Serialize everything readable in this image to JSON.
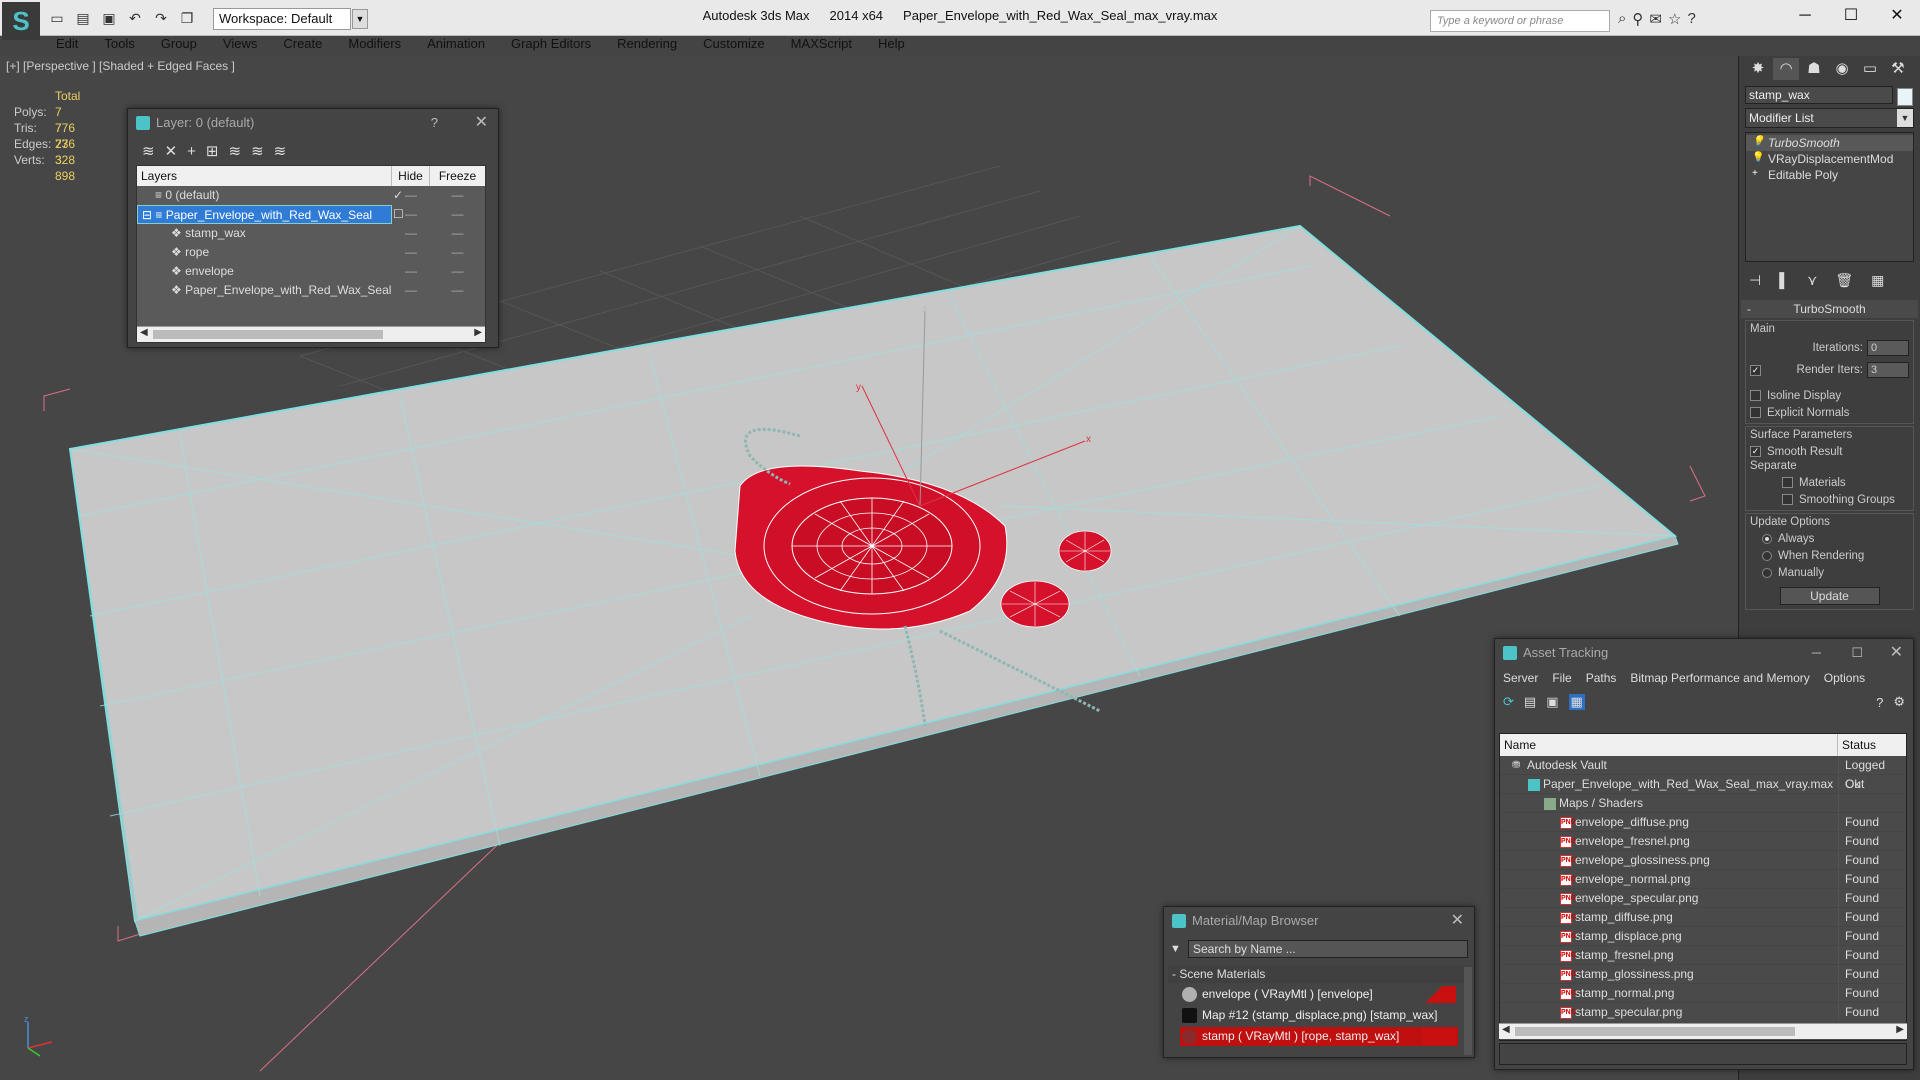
{
  "app": {
    "name": "Autodesk 3ds Max",
    "version": "2014 x64",
    "file": "Paper_Envelope_with_Red_Wax_Seal_max_vray.max",
    "workspace": "Workspace: Default",
    "search_placeholder": "Type a keyword or phrase"
  },
  "menu": [
    "Edit",
    "Tools",
    "Group",
    "Views",
    "Create",
    "Modifiers",
    "Animation",
    "Graph Editors",
    "Rendering",
    "Customize",
    "MAXScript",
    "Help"
  ],
  "viewport": {
    "label": "[+] [Perspective ] [Shaded + Edged Faces ]",
    "stats": {
      "header": "Total",
      "rows": [
        {
          "label": "Polys:",
          "value": "7 776"
        },
        {
          "label": "Tris:",
          "value": "7 776"
        },
        {
          "label": "Edges:",
          "value": "23 328"
        },
        {
          "label": "Verts:",
          "value": "3 898"
        }
      ]
    },
    "axis_labels": {
      "x": "x",
      "y": "y",
      "z": "z"
    }
  },
  "layer_dialog": {
    "title": "Layer: 0 (default)",
    "help": "?",
    "close": "✕",
    "columns": {
      "name": "Layers",
      "hide": "Hide",
      "freeze": "Freeze"
    },
    "rows": [
      {
        "name": "0 (default)",
        "indent": 1,
        "current": "✓",
        "hide": "—",
        "freeze": "—"
      },
      {
        "name": "Paper_Envelope_with_Red_Wax_Seal",
        "indent": 1,
        "selected": true,
        "current": "☐",
        "hide": "—",
        "freeze": "—"
      },
      {
        "name": "stamp_wax",
        "indent": 2,
        "current": "",
        "hide": "—",
        "freeze": "—"
      },
      {
        "name": "rope",
        "indent": 2,
        "current": "",
        "hide": "—",
        "freeze": "—"
      },
      {
        "name": "envelope",
        "indent": 2,
        "current": "",
        "hide": "—",
        "freeze": "—"
      },
      {
        "name": "Paper_Envelope_with_Red_Wax_Seal",
        "indent": 2,
        "current": "",
        "hide": "—",
        "freeze": "—"
      }
    ]
  },
  "command_panel": {
    "object_name": "stamp_wax",
    "object_color": "#e8f4f8",
    "modifier_list": "Modifier List",
    "stack": [
      {
        "name": "TurboSmooth",
        "selected": true,
        "icon": "💡"
      },
      {
        "name": "VRayDisplacementMod",
        "icon": "💡"
      },
      {
        "name": "Editable Poly",
        "icon": "+"
      }
    ],
    "rollout": {
      "title": "TurboSmooth",
      "collapse": "-",
      "main_label": "Main",
      "iterations_label": "Iterations:",
      "iterations_value": "0",
      "render_iters_label": "Render Iters:",
      "render_iters_value": "3",
      "isoline": "Isoline Display",
      "explicit_normals": "Explicit Normals",
      "surface_label": "Surface Parameters",
      "smooth_result": "Smooth Result",
      "separate_label": "Separate",
      "materials": "Materials",
      "smoothing_groups": "Smoothing Groups",
      "update_label": "Update Options",
      "always": "Always",
      "when_rendering": "When Rendering",
      "manually": "Manually",
      "update_button": "Update"
    }
  },
  "asset_tracking": {
    "title": "Asset Tracking",
    "menu": [
      "Server",
      "File",
      "Paths",
      "Bitmap Performance and Memory",
      "Options"
    ],
    "columns": {
      "name": "Name",
      "status": "Status"
    },
    "rows": [
      {
        "name": "Autodesk Vault",
        "status": "Logged Out",
        "indent": 1,
        "icon": "vault"
      },
      {
        "name": "Paper_Envelope_with_Red_Wax_Seal_max_vray.max",
        "status": "Ok",
        "indent": 2,
        "icon": "file"
      },
      {
        "name": "Maps / Shaders",
        "status": "",
        "indent": 3,
        "icon": "maps"
      },
      {
        "name": "envelope_diffuse.png",
        "status": "Found",
        "indent": 4,
        "icon": "png"
      },
      {
        "name": "envelope_fresnel.png",
        "status": "Found",
        "indent": 4,
        "icon": "png"
      },
      {
        "name": "envelope_glossiness.png",
        "status": "Found",
        "indent": 4,
        "icon": "png"
      },
      {
        "name": "envelope_normal.png",
        "status": "Found",
        "indent": 4,
        "icon": "png"
      },
      {
        "name": "envelope_specular.png",
        "status": "Found",
        "indent": 4,
        "icon": "png"
      },
      {
        "name": "stamp_diffuse.png",
        "status": "Found",
        "indent": 4,
        "icon": "png"
      },
      {
        "name": "stamp_displace.png",
        "status": "Found",
        "indent": 4,
        "icon": "png"
      },
      {
        "name": "stamp_fresnel.png",
        "status": "Found",
        "indent": 4,
        "icon": "png"
      },
      {
        "name": "stamp_glossiness.png",
        "status": "Found",
        "indent": 4,
        "icon": "png"
      },
      {
        "name": "stamp_normal.png",
        "status": "Found",
        "indent": 4,
        "icon": "png"
      },
      {
        "name": "stamp_specular.png",
        "status": "Found",
        "indent": 4,
        "icon": "png"
      }
    ]
  },
  "material_browser": {
    "title": "Material/Map Browser",
    "search_placeholder": "Search by Name ...",
    "section": "- Scene Materials",
    "rows": [
      {
        "name": "envelope  ( VRayMtl ) [envelope]",
        "swatch": "#b0b0b0",
        "red": true
      },
      {
        "name": "Map #12 (stamp_displace.png) [stamp_wax]",
        "swatch": "#111111",
        "red": false
      },
      {
        "name": "stamp  ( VRayMtl ) [rope, stamp_wax]",
        "swatch": "#8a2a2a",
        "red": true,
        "selected": true
      }
    ]
  }
}
